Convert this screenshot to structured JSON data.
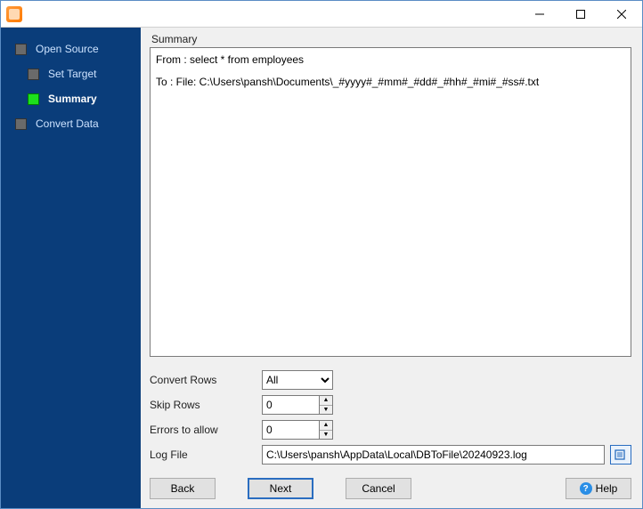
{
  "window": {
    "title": ""
  },
  "sidebar": {
    "steps": [
      {
        "label": "Open Source",
        "active": false
      },
      {
        "label": "Set Target",
        "active": false
      },
      {
        "label": "Summary",
        "active": true
      },
      {
        "label": "Convert Data",
        "active": false
      }
    ]
  },
  "summary": {
    "heading": "Summary",
    "from": "From : select * from employees",
    "to": "To : File: C:\\Users\\pansh\\Documents\\_#yyyy#_#mm#_#dd#_#hh#_#mi#_#ss#.txt"
  },
  "options": {
    "convert_rows": {
      "label": "Convert Rows",
      "value": "All"
    },
    "skip_rows": {
      "label": "Skip Rows",
      "value": "0"
    },
    "errors_allow": {
      "label": "Errors to allow",
      "value": "0"
    },
    "log_file": {
      "label": "Log File",
      "value": "C:\\Users\\pansh\\AppData\\Local\\DBToFile\\20240923.log"
    }
  },
  "buttons": {
    "back": "Back",
    "next": "Next",
    "cancel": "Cancel",
    "help": "Help"
  }
}
